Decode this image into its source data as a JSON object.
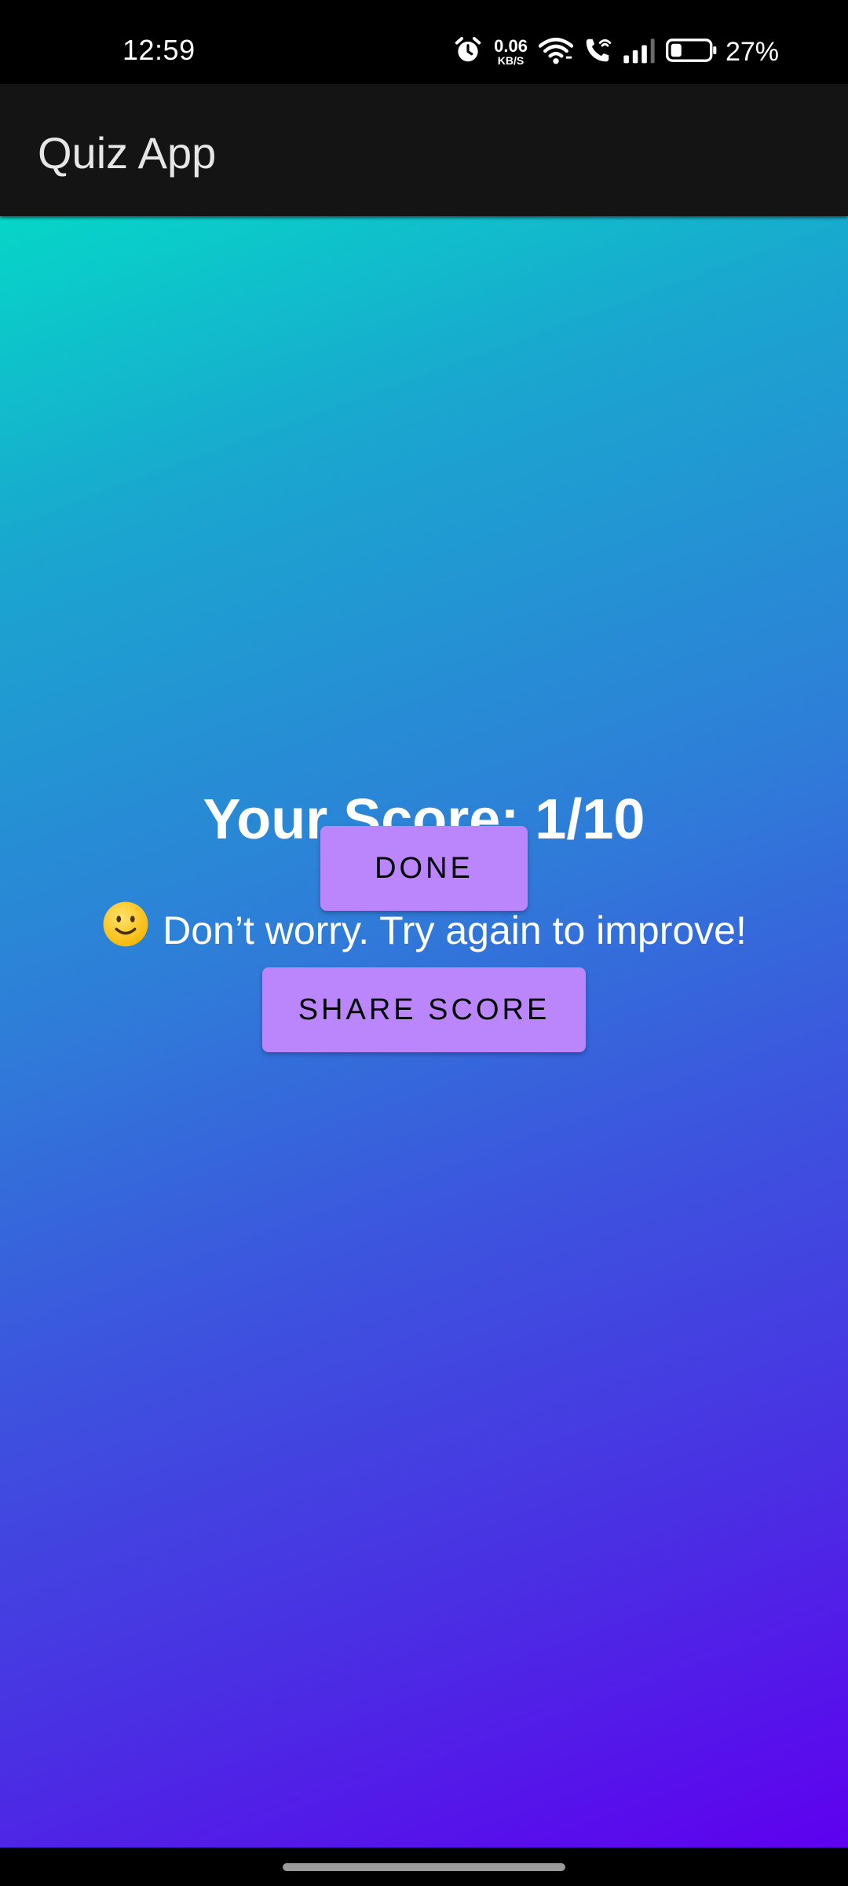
{
  "status_bar": {
    "time": "12:59",
    "net_speed_value": "0.06",
    "net_speed_unit": "KB/S",
    "battery_percent": "27%",
    "battery_level": 0.27,
    "icons": [
      "alarm-icon",
      "wifi-icon",
      "wifi-calling-icon",
      "signal-icon",
      "battery-icon"
    ]
  },
  "app_bar": {
    "title": "Quiz App"
  },
  "result": {
    "score_text": "Your Score: 1/10",
    "emoji": "🙂",
    "message": "Don’t worry. Try again to improve!"
  },
  "buttons": {
    "done_label": "DONE",
    "share_label": "SHARE SCORE"
  },
  "colors": {
    "button_bg": "#bb86fc",
    "gradient_start": "#06d6c8",
    "gradient_end": "#5e00ef",
    "app_bar_bg": "#141414"
  }
}
